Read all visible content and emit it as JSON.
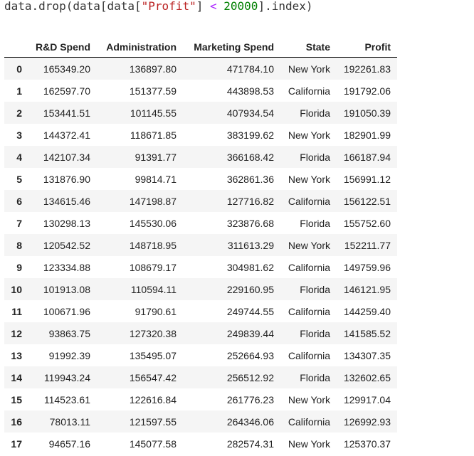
{
  "code": {
    "prefix": "data.drop(data[data[",
    "string_literal": "\"Profit\"",
    "mid": "] ",
    "operator": "<",
    "space": " ",
    "number": "20000",
    "suffix": "].index)"
  },
  "table": {
    "index_header": "",
    "columns": [
      "R&D Spend",
      "Administration",
      "Marketing Spend",
      "State",
      "Profit"
    ],
    "rows": [
      {
        "index": "0",
        "cells": [
          "165349.20",
          "136897.80",
          "471784.10",
          "New York",
          "192261.83"
        ]
      },
      {
        "index": "1",
        "cells": [
          "162597.70",
          "151377.59",
          "443898.53",
          "California",
          "191792.06"
        ]
      },
      {
        "index": "2",
        "cells": [
          "153441.51",
          "101145.55",
          "407934.54",
          "Florida",
          "191050.39"
        ]
      },
      {
        "index": "3",
        "cells": [
          "144372.41",
          "118671.85",
          "383199.62",
          "New York",
          "182901.99"
        ]
      },
      {
        "index": "4",
        "cells": [
          "142107.34",
          "91391.77",
          "366168.42",
          "Florida",
          "166187.94"
        ]
      },
      {
        "index": "5",
        "cells": [
          "131876.90",
          "99814.71",
          "362861.36",
          "New York",
          "156991.12"
        ]
      },
      {
        "index": "6",
        "cells": [
          "134615.46",
          "147198.87",
          "127716.82",
          "California",
          "156122.51"
        ]
      },
      {
        "index": "7",
        "cells": [
          "130298.13",
          "145530.06",
          "323876.68",
          "Florida",
          "155752.60"
        ]
      },
      {
        "index": "8",
        "cells": [
          "120542.52",
          "148718.95",
          "311613.29",
          "New York",
          "152211.77"
        ]
      },
      {
        "index": "9",
        "cells": [
          "123334.88",
          "108679.17",
          "304981.62",
          "California",
          "149759.96"
        ]
      },
      {
        "index": "10",
        "cells": [
          "101913.08",
          "110594.11",
          "229160.95",
          "Florida",
          "146121.95"
        ]
      },
      {
        "index": "11",
        "cells": [
          "100671.96",
          "91790.61",
          "249744.55",
          "California",
          "144259.40"
        ]
      },
      {
        "index": "12",
        "cells": [
          "93863.75",
          "127320.38",
          "249839.44",
          "Florida",
          "141585.52"
        ]
      },
      {
        "index": "13",
        "cells": [
          "91992.39",
          "135495.07",
          "252664.93",
          "California",
          "134307.35"
        ]
      },
      {
        "index": "14",
        "cells": [
          "119943.24",
          "156547.42",
          "256512.92",
          "Florida",
          "132602.65"
        ]
      },
      {
        "index": "15",
        "cells": [
          "114523.61",
          "122616.84",
          "261776.23",
          "New York",
          "129917.04"
        ]
      },
      {
        "index": "16",
        "cells": [
          "78013.11",
          "121597.55",
          "264346.06",
          "California",
          "126992.93"
        ]
      },
      {
        "index": "17",
        "cells": [
          "94657.16",
          "145077.58",
          "282574.31",
          "New York",
          "125370.37"
        ]
      }
    ]
  }
}
